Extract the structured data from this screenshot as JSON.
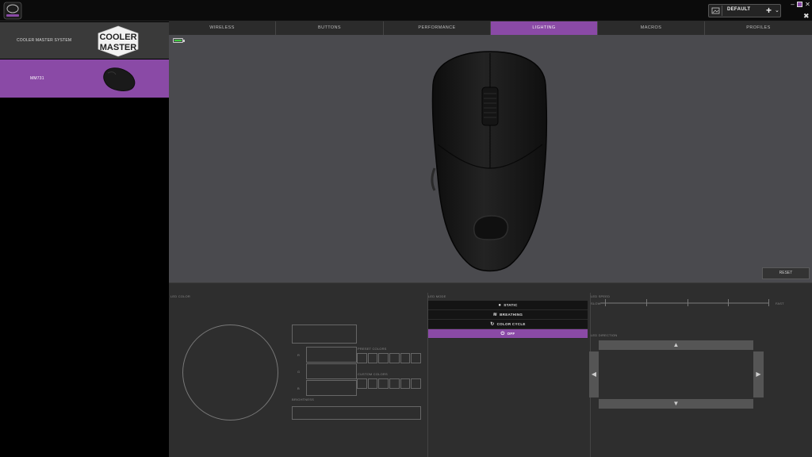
{
  "app": {
    "logo_icon": "masterplus-logo-icon",
    "accent_color": "#8a4aa6"
  },
  "titlebar": {
    "profile": {
      "name": "DEFAULT",
      "add_label": "+",
      "dropdown_icon": "chevron-down-icon"
    },
    "window_controls": [
      "minimize",
      "restore",
      "close"
    ]
  },
  "sidebar": {
    "brand": {
      "label": "COOLER MASTER SYSTEM",
      "logo_text_line1": "COOLER",
      "logo_text_line2": "MASTER"
    },
    "device": {
      "label": "MM731"
    }
  },
  "tabs": [
    {
      "label": "WIRELESS",
      "active": false
    },
    {
      "label": "BUTTONS",
      "active": false
    },
    {
      "label": "PERFORMANCE",
      "active": false
    },
    {
      "label": "LIGHTING",
      "active": true
    },
    {
      "label": "MACROS",
      "active": false
    },
    {
      "label": "PROFILES",
      "active": false
    }
  ],
  "preview": {
    "battery_level": 0.8,
    "reset_label": "RESET"
  },
  "lighting": {
    "led_color_label": "LED COLOR",
    "rgb_letters": [
      "R",
      "G",
      "B"
    ],
    "preset_colors_label": "PRESET COLORS",
    "custom_colors_label": "CUSTOM COLORS",
    "brightness_label": "BRIGHTNESS",
    "led_mode_label": "LED MODE",
    "effects": [
      {
        "label": "STATIC",
        "icon": "static-icon",
        "active": false
      },
      {
        "label": "BREATHING",
        "icon": "breathing-icon",
        "active": false
      },
      {
        "label": "COLOR CYCLE",
        "icon": "cycle-icon",
        "active": false
      },
      {
        "label": "OFF",
        "icon": "power-icon",
        "active": true
      }
    ],
    "speed_label": "LED SPEED",
    "speed_min": "SLOW",
    "speed_max": "FAST",
    "direction_label": "LED DIRECTION"
  }
}
